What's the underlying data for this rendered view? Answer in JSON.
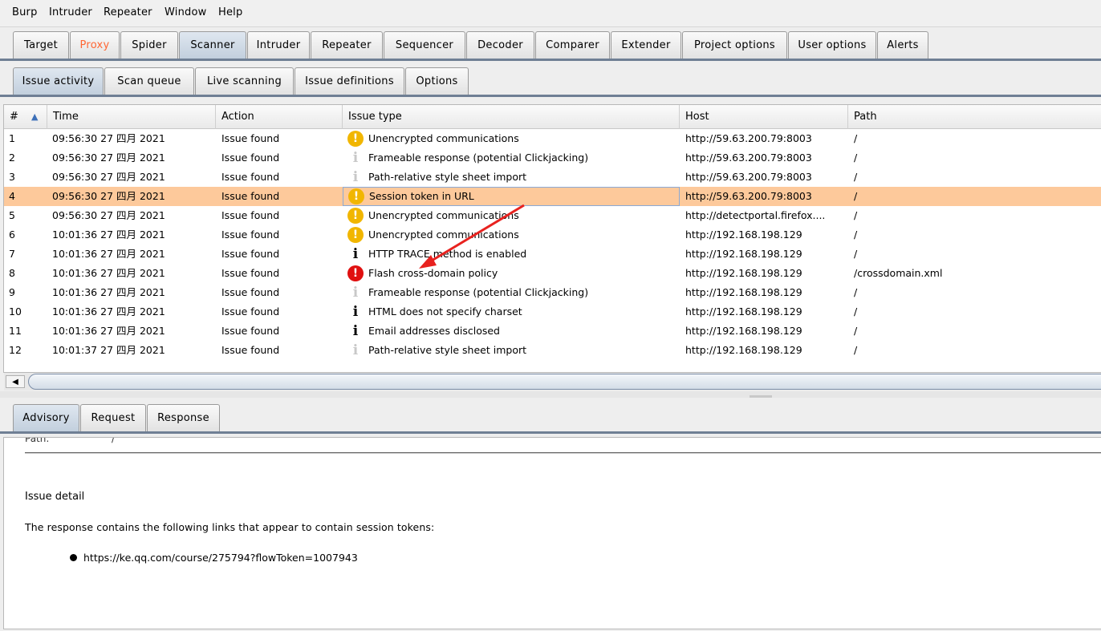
{
  "menubar": [
    "Burp",
    "Intruder",
    "Repeater",
    "Window",
    "Help"
  ],
  "main_tabs": [
    "Target",
    "Proxy",
    "Spider",
    "Scanner",
    "Intruder",
    "Repeater",
    "Sequencer",
    "Decoder",
    "Comparer",
    "Extender",
    "Project options",
    "User options",
    "Alerts"
  ],
  "main_tab_selected": "Scanner",
  "main_tab_highlight": "Proxy",
  "scanner_tabs": [
    "Issue activity",
    "Scan queue",
    "Live scanning",
    "Issue definitions",
    "Options"
  ],
  "scanner_tab_selected": "Issue activity",
  "table": {
    "columns": [
      "#",
      "Time",
      "Action",
      "Issue type",
      "Host",
      "Path"
    ],
    "sort_indicator": "▲",
    "rows": [
      {
        "num": "1",
        "time": "09:56:30 27 四月 2021",
        "action": "Issue found",
        "severity": "medium",
        "issue": "Unencrypted communications",
        "host": "http://59.63.200.79:8003",
        "path": "/"
      },
      {
        "num": "2",
        "time": "09:56:30 27 四月 2021",
        "action": "Issue found",
        "severity": "info-light",
        "issue": "Frameable response (potential Clickjacking)",
        "host": "http://59.63.200.79:8003",
        "path": "/"
      },
      {
        "num": "3",
        "time": "09:56:30 27 四月 2021",
        "action": "Issue found",
        "severity": "info-light",
        "issue": "Path-relative style sheet import",
        "host": "http://59.63.200.79:8003",
        "path": "/"
      },
      {
        "num": "4",
        "time": "09:56:30 27 四月 2021",
        "action": "Issue found",
        "severity": "medium",
        "issue": "Session token in URL",
        "host": "http://59.63.200.79:8003",
        "path": "/",
        "selected": true
      },
      {
        "num": "5",
        "time": "09:56:30 27 四月 2021",
        "action": "Issue found",
        "severity": "medium",
        "issue": "Unencrypted communications",
        "host": "http://detectportal.firefox....",
        "path": "/"
      },
      {
        "num": "6",
        "time": "10:01:36 27 四月 2021",
        "action": "Issue found",
        "severity": "medium",
        "issue": "Unencrypted communications",
        "host": "http://192.168.198.129",
        "path": "/"
      },
      {
        "num": "7",
        "time": "10:01:36 27 四月 2021",
        "action": "Issue found",
        "severity": "info",
        "issue": "HTTP TRACE method is enabled",
        "host": "http://192.168.198.129",
        "path": "/"
      },
      {
        "num": "8",
        "time": "10:01:36 27 四月 2021",
        "action": "Issue found",
        "severity": "high",
        "issue": "Flash cross-domain policy",
        "host": "http://192.168.198.129",
        "path": "/crossdomain.xml"
      },
      {
        "num": "9",
        "time": "10:01:36 27 四月 2021",
        "action": "Issue found",
        "severity": "info-light",
        "issue": "Frameable response (potential Clickjacking)",
        "host": "http://192.168.198.129",
        "path": "/"
      },
      {
        "num": "10",
        "time": "10:01:36 27 四月 2021",
        "action": "Issue found",
        "severity": "info",
        "issue": "HTML does not specify charset",
        "host": "http://192.168.198.129",
        "path": "/"
      },
      {
        "num": "11",
        "time": "10:01:36 27 四月 2021",
        "action": "Issue found",
        "severity": "info",
        "issue": "Email addresses disclosed",
        "host": "http://192.168.198.129",
        "path": "/"
      },
      {
        "num": "12",
        "time": "10:01:37 27 四月 2021",
        "action": "Issue found",
        "severity": "info-light",
        "issue": "Path-relative style sheet import",
        "host": "http://192.168.198.129",
        "path": "/"
      }
    ]
  },
  "detail_tabs": [
    "Advisory",
    "Request",
    "Response"
  ],
  "detail_tab_selected": "Advisory",
  "advisory": {
    "cut_label": "Path:",
    "cut_value": "/",
    "heading": "Issue detail",
    "paragraph": "The response contains the following links that appear to contain session tokens:",
    "links": [
      "https://ke.qq.com/course/275794?flowToken=1007943"
    ]
  },
  "colors": {
    "selected_row": "#fdc99b",
    "medium_severity": "#f1b600",
    "high_severity": "#e01010",
    "proxy_tab_text": "#ff6633",
    "annotation_arrow": "#e8221f"
  },
  "icons": {
    "medium": "exclamation-circle-orange-icon",
    "high": "exclamation-circle-red-icon",
    "info": "info-i-icon",
    "info-light": "info-i-light-icon",
    "scroll_left": "arrow-left-icon"
  }
}
